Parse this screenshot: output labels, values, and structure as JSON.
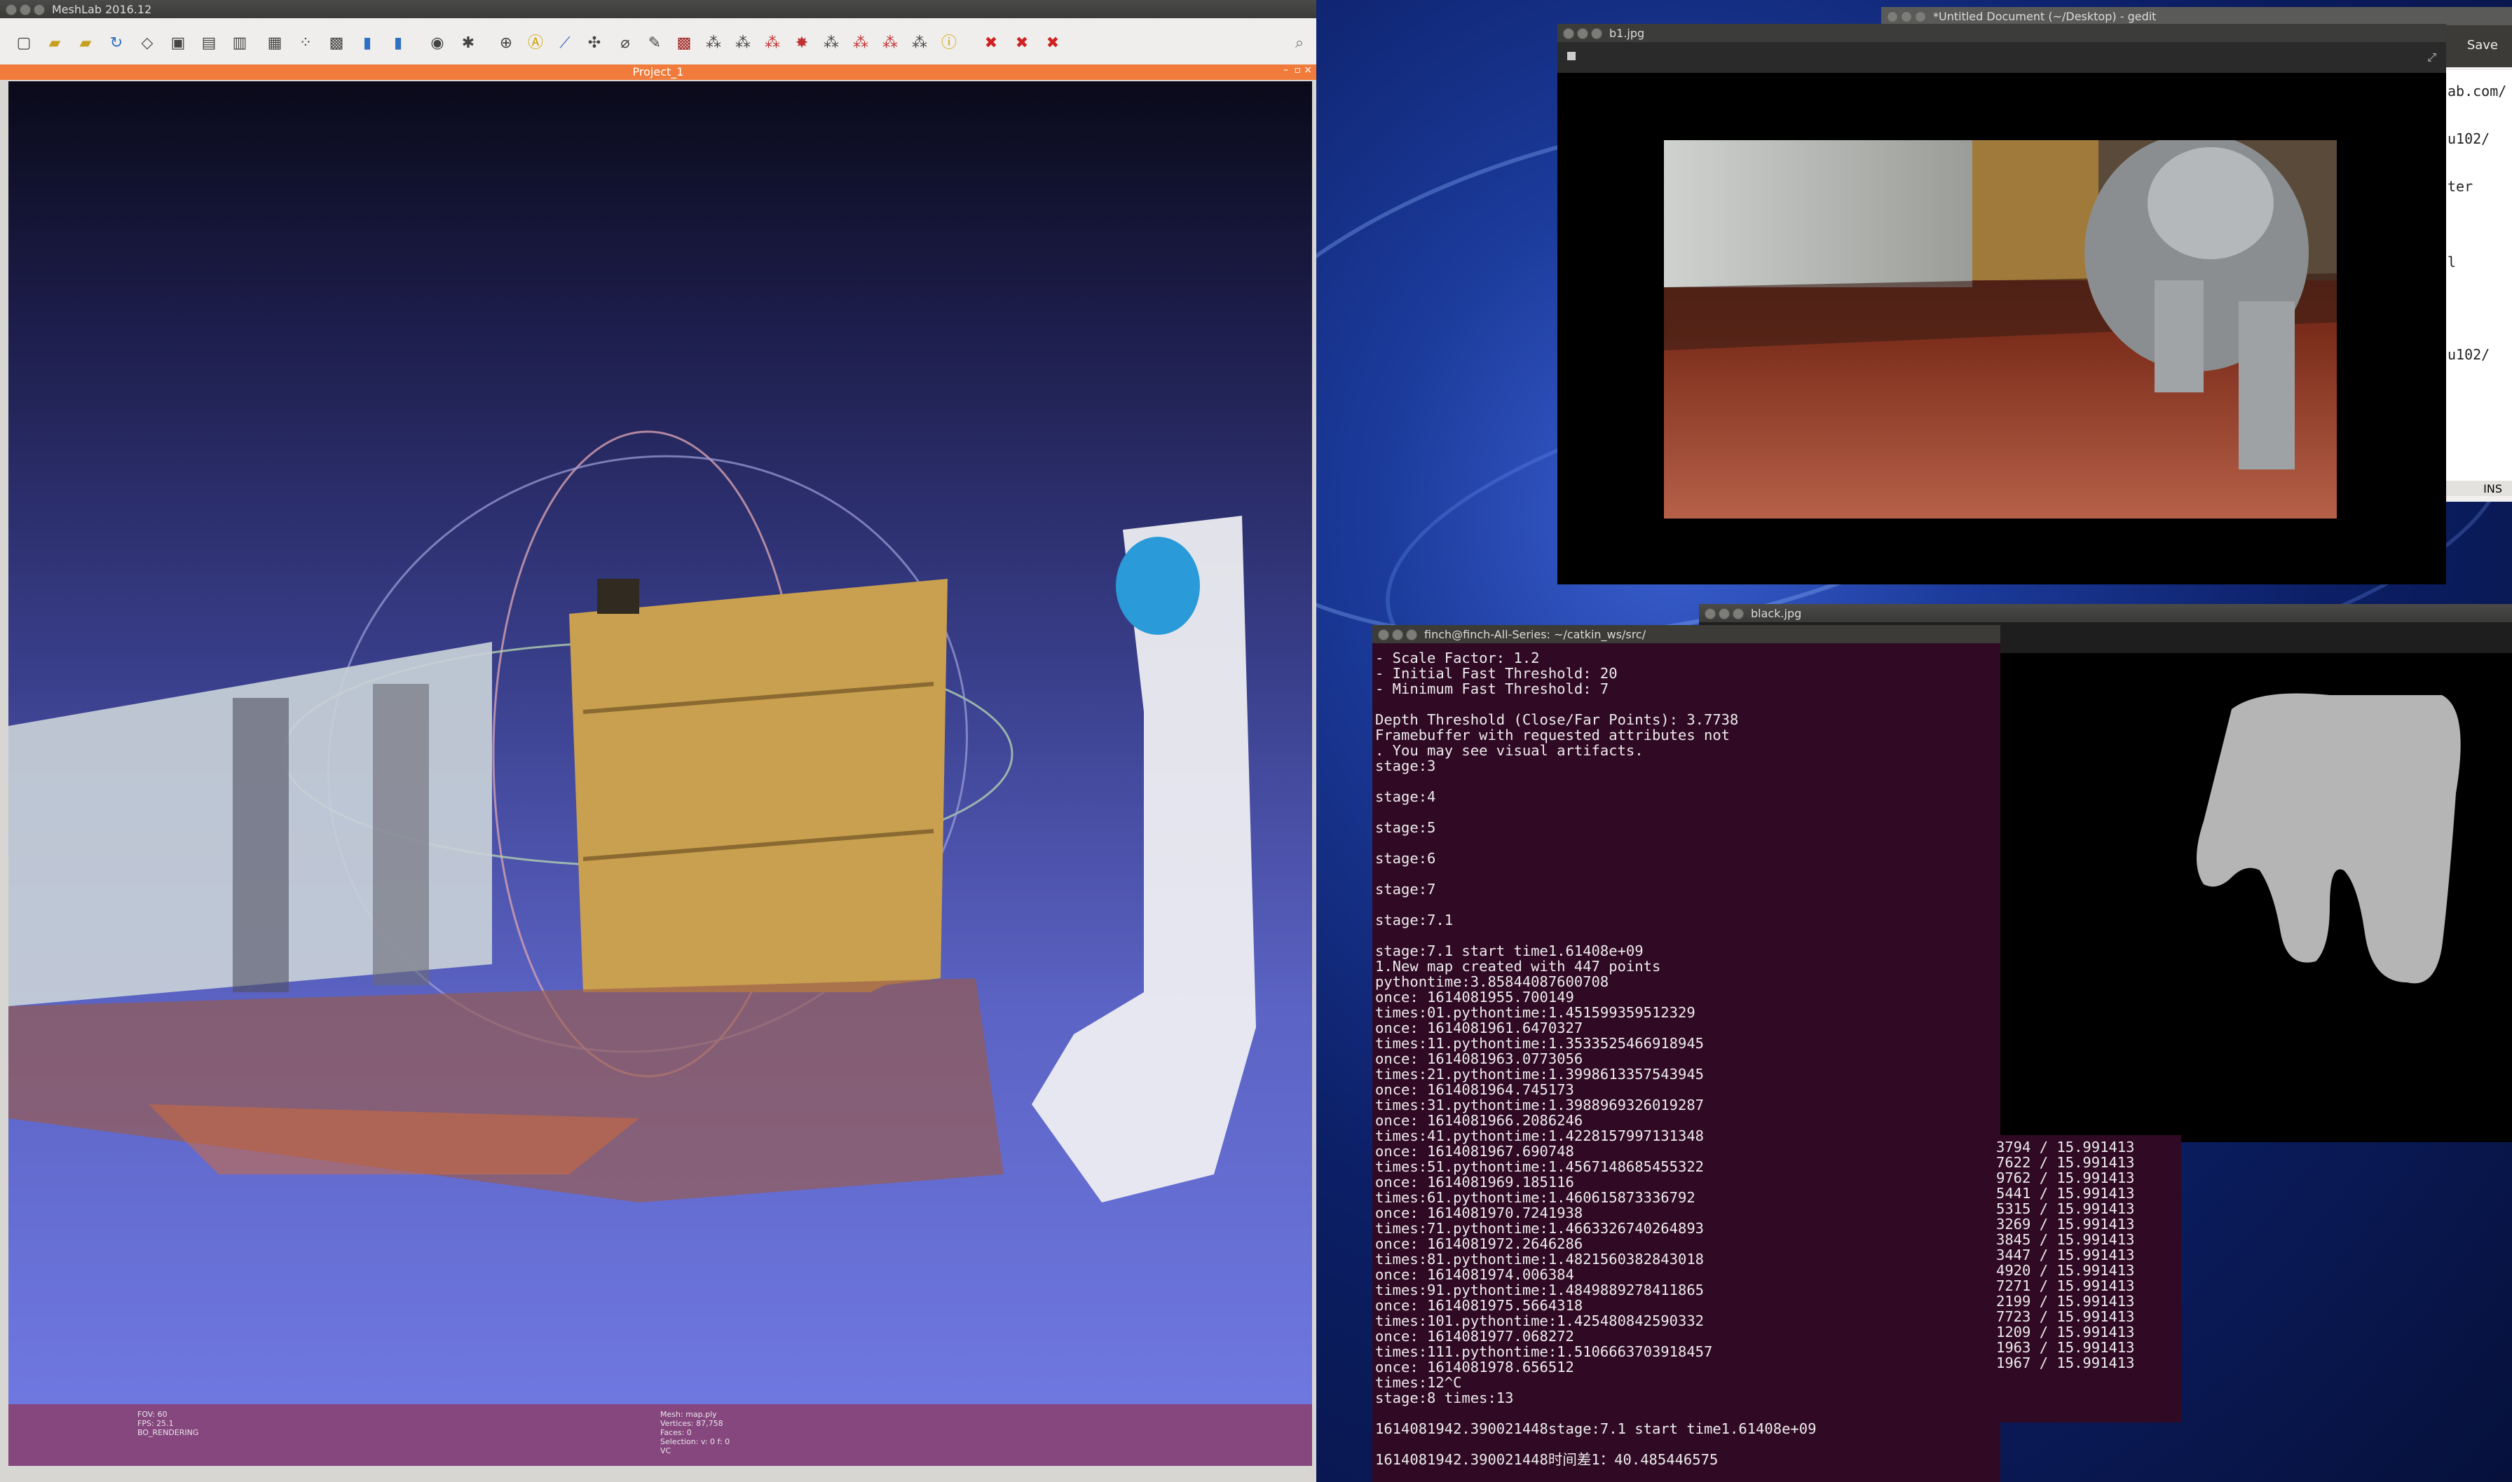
{
  "meshlab": {
    "title": "MeshLab 2016.12",
    "project_tab": "Project_1",
    "info_left": [
      "FOV: 60",
      "FPS:   25.1",
      "BO_RENDERING"
    ],
    "info_right": [
      "Mesh: map.ply",
      "Vertices: 87,758",
      "Faces: 0",
      "Selection: v: 0 f: 0",
      "VC"
    ]
  },
  "b1": {
    "title": "b1.jpg"
  },
  "black": {
    "title": "black.jpg"
  },
  "gedit": {
    "title": "*Untitled Document (~/Desktop) - gedit",
    "save_label": "Save",
    "status": "INS",
    "lines": [
      "ab.com/",
      "u102/",
      "ter",
      "l",
      "u102/"
    ]
  },
  "terminal": {
    "title": "finch@finch-All-Series: ~/catkin_ws/src/",
    "lines": [
      "- Scale Factor: 1.2",
      "- Initial Fast Threshold: 20",
      "- Minimum Fast Threshold: 7",
      "",
      "Depth Threshold (Close/Far Points): 3.7738",
      "Framebuffer with requested attributes not",
      ". You may see visual artifacts.",
      "stage:3",
      "",
      "stage:4",
      "",
      "stage:5",
      "",
      "stage:6",
      "",
      "stage:7",
      "",
      "stage:7.1",
      "",
      "stage:7.1 start time1.61408e+09",
      "1.New map created with 447 points",
      "pythontime:3.85844087600708",
      "once: 1614081955.700149",
      "times:01.pythontime:1.451599359512329",
      "once: 1614081961.6470327",
      "times:11.pythontime:1.3533525466918945",
      "once: 1614081963.0773056",
      "times:21.pythontime:1.3998613357543945",
      "once: 1614081964.745173",
      "times:31.pythontime:1.3988969326019287",
      "once: 1614081966.2086246",
      "times:41.pythontime:1.4228157997131348",
      "once: 1614081967.690748",
      "times:51.pythontime:1.4567148685455322",
      "once: 1614081969.185116",
      "times:61.pythontime:1.460615873336792",
      "once: 1614081970.7241938",
      "times:71.pythontime:1.4663326740264893",
      "once: 1614081972.2646286",
      "times:81.pythontime:1.4821560382843018",
      "once: 1614081974.006384",
      "times:91.pythontime:1.4849889278411865",
      "once: 1614081975.5664318",
      "times:101.pythontime:1.425480842590332",
      "once: 1614081977.068272",
      "times:111.pythontime:1.5106663703918457",
      "once: 1614081978.656512",
      "times:12^C",
      "stage:8 times:13",
      "",
      "1614081942.390021448stage:7.1 start time1.61408e+09",
      "",
      "1614081942.390021448时间差1：40.485446575"
    ],
    "side_lines": [
      "3794 / 15.991413",
      "7622 / 15.991413",
      "9762 / 15.991413",
      "5441 / 15.991413",
      "5315 / 15.991413",
      "3269 / 15.991413",
      "3845 / 15.991413",
      "3447 / 15.991413",
      "4920 / 15.991413",
      "7271 / 15.991413",
      "2199 / 15.991413",
      "7723 / 15.991413",
      "1209 / 15.991413",
      "1963 / 15.991413",
      "1967 / 15.991413"
    ]
  }
}
